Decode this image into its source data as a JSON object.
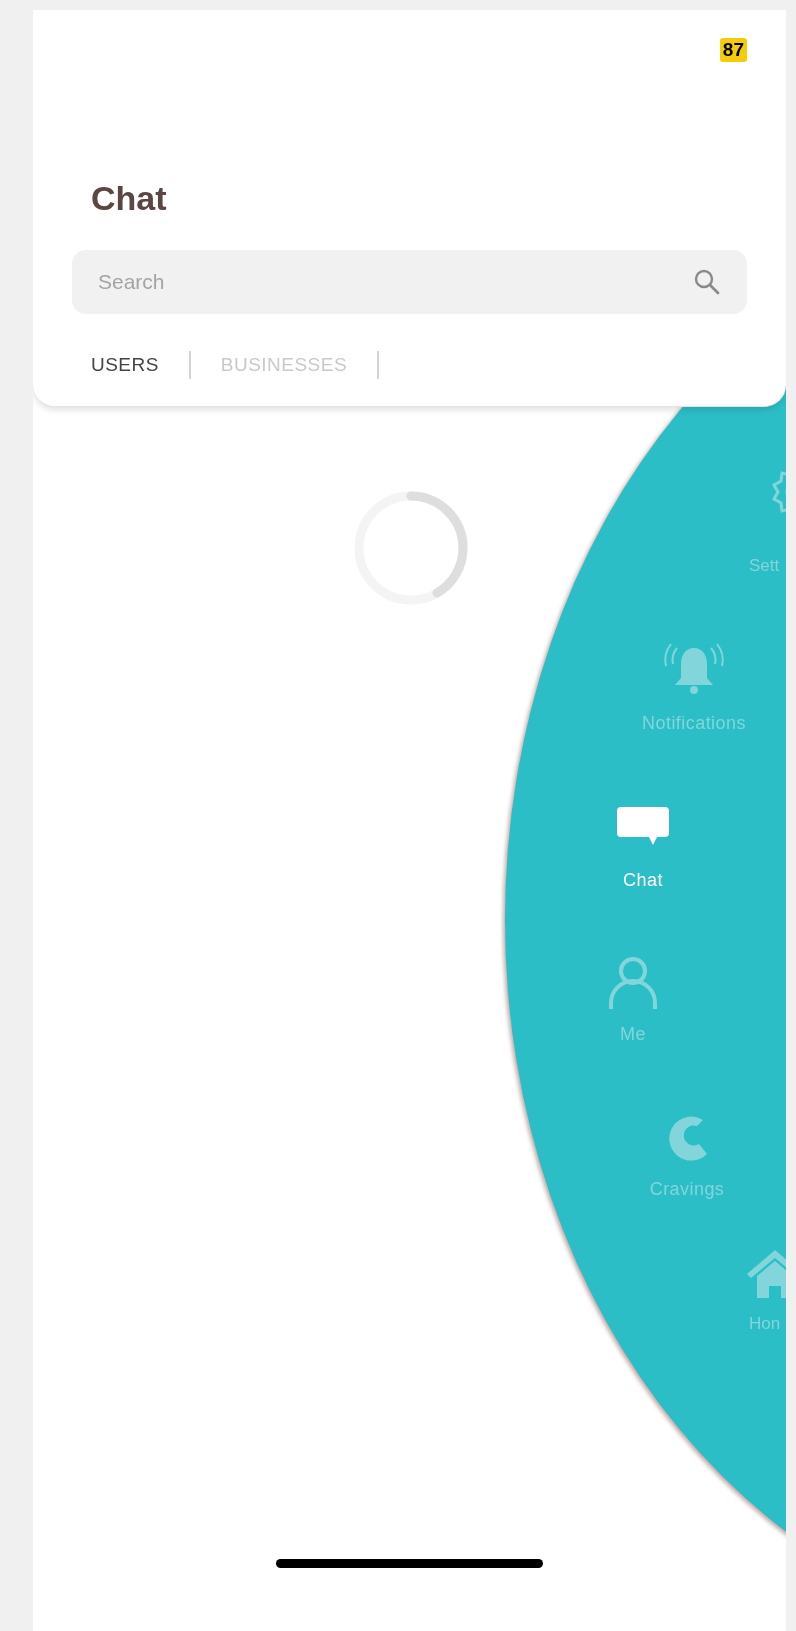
{
  "badge": "87",
  "title": "Chat",
  "search": {
    "placeholder": "Search"
  },
  "tabs": [
    {
      "label": "USERS",
      "selected": true
    },
    {
      "label": "BUSINESSES",
      "selected": false
    }
  ],
  "menu": [
    {
      "label": "Sett",
      "selected": false
    },
    {
      "label": "Notifications",
      "selected": false
    },
    {
      "label": "Chat",
      "selected": true
    },
    {
      "label": "Me",
      "selected": false
    },
    {
      "label": "Cravings",
      "selected": false
    },
    {
      "label": "Hon",
      "selected": false
    }
  ]
}
